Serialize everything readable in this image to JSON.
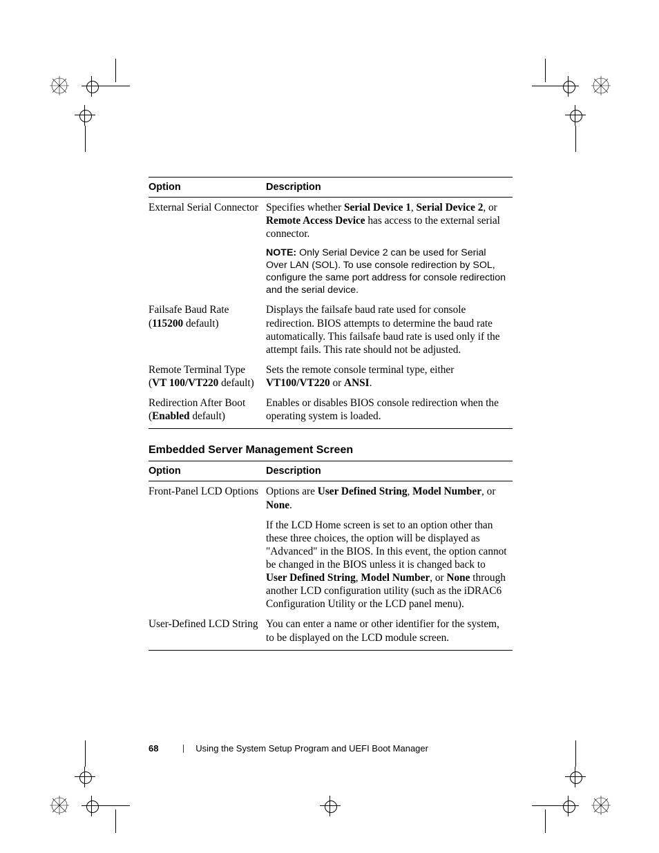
{
  "table1": {
    "headers": {
      "option": "Option",
      "description": "Description"
    },
    "rows": [
      {
        "option": "External Serial Connector",
        "desc_pre": "Specifies whether ",
        "b1": "Serial Device 1",
        "sep1": ", ",
        "b2": "Serial Device 2",
        "sep2": ", or ",
        "b3": "Remote Access Device",
        "desc_post": " has access to the external serial connector.",
        "note_label": "NOTE:",
        "note_body": " Only Serial Device 2 can be used for Serial Over LAN (SOL). To use console redirection by SOL, configure the same port address for console redirection and the serial device."
      },
      {
        "opt_line1": "Failsafe Baud Rate",
        "opt_open": "(",
        "opt_bold": "115200",
        "opt_close": " default)",
        "desc": "Displays the failsafe baud rate used for console redirection. BIOS attempts to determine the baud rate automatically. This failsafe baud rate is used only if the attempt fails. This rate should not be adjusted."
      },
      {
        "opt_line1": "Remote Terminal Type",
        "opt_open": "(",
        "opt_bold": "VT 100/VT220",
        "opt_close": " default)",
        "desc_pre": "Sets the remote console terminal type, either ",
        "b1": "VT100/VT220",
        "sep1": " or ",
        "b2": "ANSI",
        "desc_post": "."
      },
      {
        "opt_line1": "Redirection After Boot",
        "opt_open": "(",
        "opt_bold": "Enabled",
        "opt_close": " default)",
        "desc": "Enables or disables BIOS console redirection when the operating system is loaded."
      }
    ]
  },
  "section_heading": "Embedded Server Management Screen",
  "table2": {
    "headers": {
      "option": "Option",
      "description": "Description"
    },
    "rows": [
      {
        "option": "Front-Panel LCD Options",
        "desc_pre": "Options are ",
        "b1": "User Defined String",
        "sep1": ", ",
        "b2": "Model Number",
        "sep2": ", or ",
        "b3": "None",
        "desc_post": ".",
        "para2_pre": "If the LCD Home screen is set to an option other than these three choices, the option will be displayed as \"Advanced\" in the BIOS. In this event, the option cannot be changed in the BIOS unless it is changed back to ",
        "p2b1": "User Defined String",
        "p2s1": ", ",
        "p2b2": "Model Number",
        "p2s2": ", or ",
        "p2b3": "None",
        "para2_post": " through another LCD configuration utility (such as the iDRAC6 Configuration Utility or the LCD panel menu)."
      },
      {
        "option": "User-Defined LCD String",
        "desc": "You can enter a name or other identifier for the system, to be displayed on the LCD module screen."
      }
    ]
  },
  "footer": {
    "page_number": "68",
    "running_title": "Using the System Setup Program and UEFI Boot Manager"
  }
}
